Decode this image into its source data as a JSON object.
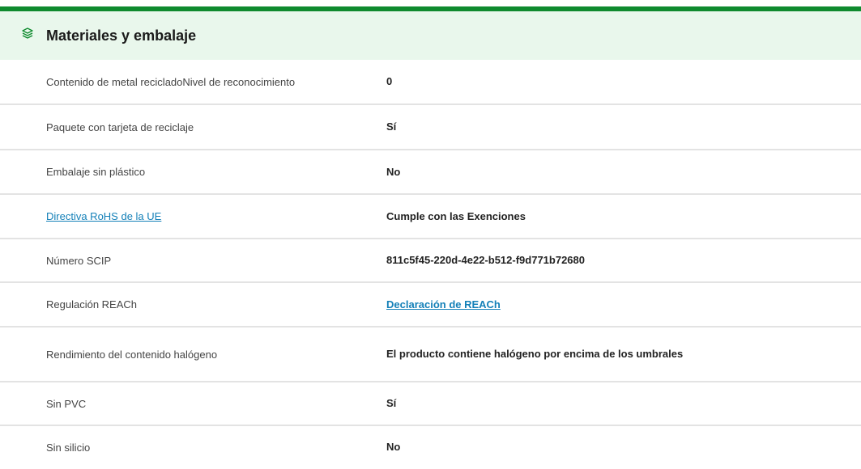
{
  "colors": {
    "accent_bar": "#0f8a2e",
    "header_bg": "#e9f7ec",
    "link": "#1480b8",
    "divider": "#e3e3e3"
  },
  "section": {
    "icon": "leaf-layers-icon",
    "title": "Materiales y embalaje"
  },
  "rows": [
    {
      "label": "Contenido de metal recicladoNivel de reconocimiento",
      "value": "0"
    },
    {
      "label": "Paquete con tarjeta de reciclaje",
      "value": "Sí"
    },
    {
      "label": "Embalaje sin plástico",
      "value": "No"
    },
    {
      "label": "Directiva RoHS de la UE",
      "value": "Cumple con las Exenciones",
      "label_is_link": true
    },
    {
      "label": "Número SCIP",
      "value": "811c5f45-220d-4e22-b512-f9d771b72680"
    },
    {
      "label": "Regulación REACh",
      "value": "Declaración de REACh",
      "value_is_link": true
    },
    {
      "label": "Rendimiento del contenido halógeno",
      "value": "El producto contiene halógeno por encima de los umbrales"
    },
    {
      "label": "Sin PVC",
      "value": "Sí"
    },
    {
      "label": "Sin silicio",
      "value": "No"
    }
  ]
}
